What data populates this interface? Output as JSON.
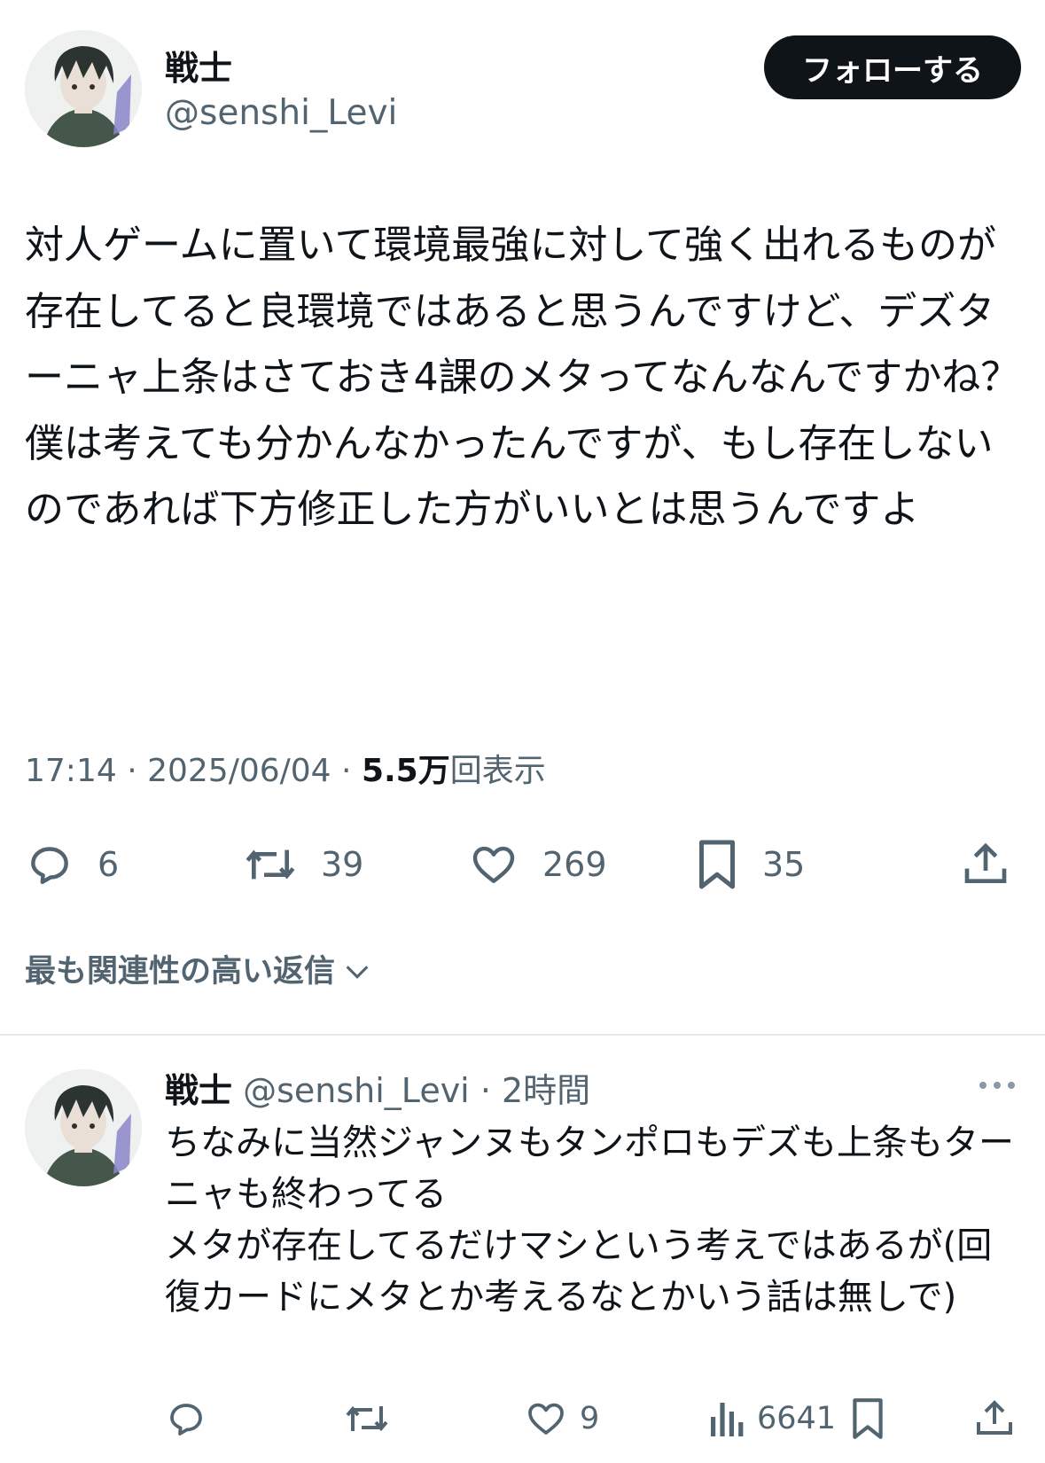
{
  "tweet": {
    "author_name": "戦士",
    "author_handle": "@senshi_Levi",
    "follow_label": "フォローする",
    "body": "対人ゲームに置いて環境最強に対して強く出れるものが存在してると良環境ではあると思うんですけど、デズターニャ上条はさておき4課のメタってなんなんですかね？\n僕は考えても分かんなかったんですが、もし存在しないのであれば下方修正した方がいいとは思うんですよ",
    "time": "17:14",
    "date": "2025/06/04",
    "views_count": "5.5万",
    "views_label": "回表示",
    "replies": "6",
    "reposts": "39",
    "likes": "269",
    "bookmarks": "35"
  },
  "sort": {
    "label": "最も関連性の高い返信"
  },
  "reply": {
    "author_name": "戦士",
    "author_handle": "@senshi_Levi",
    "time": "2時間",
    "body": "ちなみに当然ジャンヌもタンポロもデズも上条もターニャも終わってる\nメタが存在してるだけマシという考えではあるが(回復カードにメタとか考えるなとかいう話は無しで)",
    "likes": "9",
    "views": "6641"
  },
  "icons": {
    "reply": "speech-bubble-icon",
    "repost": "repost-arrows-icon",
    "like": "heart-icon",
    "bookmark": "bookmark-icon",
    "share": "share-upload-icon",
    "views": "bar-chart-icon",
    "more": "more-dots-icon",
    "chevron": "chevron-down-icon"
  },
  "colors": {
    "text": "#0f1419",
    "secondary": "#536471",
    "button_bg": "#0f1419",
    "divider": "#e6e9ea"
  }
}
